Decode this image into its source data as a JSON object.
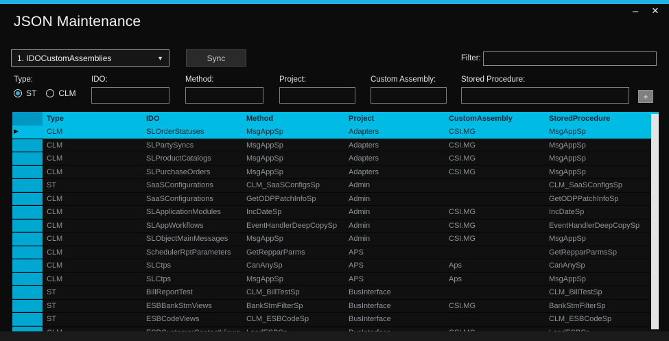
{
  "window": {
    "title": "JSON Maintenance",
    "minimize_glyph": "–",
    "close_glyph": "✕"
  },
  "colors": {
    "accent": "#1fb2e2",
    "grid_header": "#00bce5",
    "row_header_column": "#00a7d0",
    "selected_row": "#00bce5",
    "row_text": "#8d9396"
  },
  "toolbar": {
    "dataset_dropdown_value": "1. IDOCustomAssemblies",
    "dropdown_caret": "▼",
    "sync_label": "Sync",
    "filter_label": "Filter:",
    "filter_value": ""
  },
  "form": {
    "type_label": "Type:",
    "radios": [
      {
        "label": "ST",
        "selected": true
      },
      {
        "label": "CLM",
        "selected": false
      }
    ],
    "fields": [
      {
        "label": "IDO:",
        "value": ""
      },
      {
        "label": "Method:",
        "value": ""
      },
      {
        "label": "Project:",
        "value": ""
      },
      {
        "label": "Custom Assembly:",
        "value": ""
      },
      {
        "label": "Stored Procedure:",
        "value": ""
      }
    ],
    "add_button_label": "+"
  },
  "grid": {
    "columns": [
      "Type",
      "IDO",
      "Method",
      "Project",
      "CustomAssembly",
      "StoredProcedure"
    ],
    "selected_row_index": 0,
    "selector_arrow": "▶",
    "rows": [
      [
        "CLM",
        "SLOrderStatuses",
        "MsgAppSp",
        "Adapters",
        "CSI.MG",
        "MsgAppSp"
      ],
      [
        "CLM",
        "SLPartySyncs",
        "MsgAppSp",
        "Adapters",
        "CSI.MG",
        "MsgAppSp"
      ],
      [
        "CLM",
        "SLProductCatalogs",
        "MsgAppSp",
        "Adapters",
        "CSI.MG",
        "MsgAppSp"
      ],
      [
        "CLM",
        "SLPurchaseOrders",
        "MsgAppSp",
        "Adapters",
        "CSI.MG",
        "MsgAppSp"
      ],
      [
        "ST",
        "SaaSConfigurations",
        "CLM_SaaSConfigsSp",
        "Admin",
        "",
        "CLM_SaaSConfigsSp"
      ],
      [
        "CLM",
        "SaaSConfigurations",
        "GetODPPatchInfoSp",
        "Admin",
        "",
        "GetODPPatchInfoSp"
      ],
      [
        "CLM",
        "SLApplicationModules",
        "IncDateSp",
        "Admin",
        "CSI.MG",
        "IncDateSp"
      ],
      [
        "CLM",
        "SLAppWorkflows",
        "EventHandlerDeepCopySp",
        "Admin",
        "CSI.MG",
        "EventHandlerDeepCopySp"
      ],
      [
        "CLM",
        "SLObjectMainMessages",
        "MsgAppSp",
        "Admin",
        "CSI.MG",
        "MsgAppSp"
      ],
      [
        "CLM",
        "SchedulerRptParameters",
        "GetRepparParms",
        "APS",
        "",
        "GetRepparParmsSp"
      ],
      [
        "CLM",
        "SLCtps",
        "CanAnySp",
        "APS",
        "Aps",
        "CanAnySp"
      ],
      [
        "CLM",
        "SLCtps",
        "MsgAppSp",
        "APS",
        "Aps",
        "MsgAppSp"
      ],
      [
        "ST",
        "BillReportTest",
        "CLM_BillTestSp",
        "BusInterface",
        "",
        "CLM_BillTestSp"
      ],
      [
        "ST",
        "ESBBankStmViews",
        "BankStmFilterSp",
        "BusInterface",
        "CSI.MG",
        "BankStmFilterSp"
      ],
      [
        "ST",
        "ESBCodeViews",
        "CLM_ESBCodeSp",
        "BusInterface",
        "",
        "CLM_ESBCodeSp"
      ],
      [
        "CLM",
        "ESBCustomerContactViews",
        "LoadESBSp",
        "BusInterface",
        "CSI.MG",
        "LoadESBSp"
      ]
    ]
  }
}
